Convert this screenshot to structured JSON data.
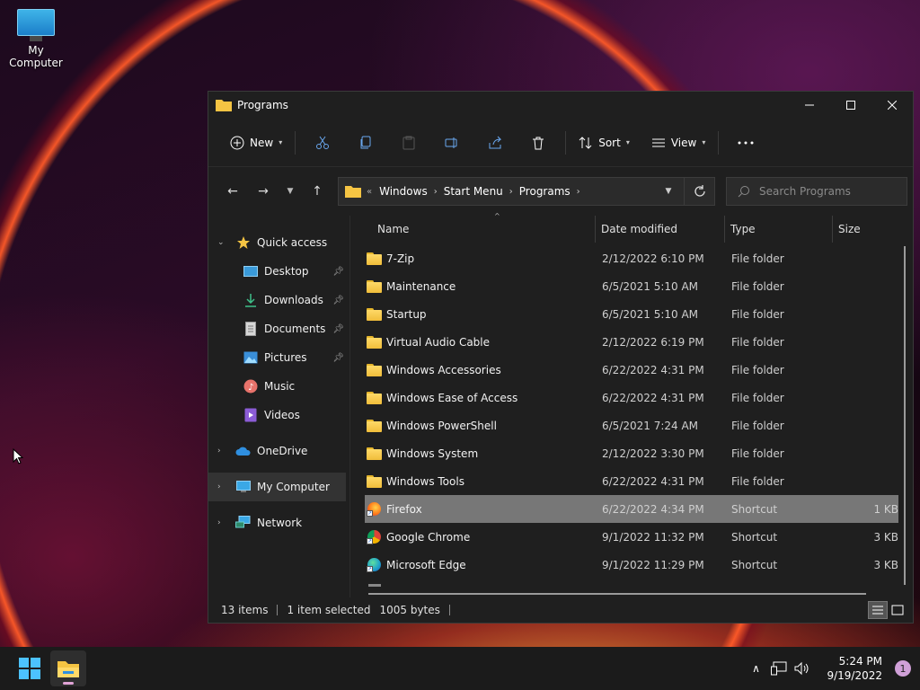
{
  "desktop": {
    "icon_label": "My Computer"
  },
  "window": {
    "title": "Programs",
    "toolbar": {
      "new_label": "New",
      "sort_label": "Sort",
      "view_label": "View"
    },
    "address": {
      "crumbs": [
        "Windows",
        "Start Menu",
        "Programs"
      ]
    },
    "search": {
      "placeholder": "Search Programs"
    },
    "sidebar": {
      "quick_access": "Quick access",
      "items": [
        {
          "label": "Desktop",
          "pinned": true
        },
        {
          "label": "Downloads",
          "pinned": true
        },
        {
          "label": "Documents",
          "pinned": true
        },
        {
          "label": "Pictures",
          "pinned": true
        },
        {
          "label": "Music",
          "pinned": false
        },
        {
          "label": "Videos",
          "pinned": false
        }
      ],
      "onedrive": "OneDrive",
      "mycomputer": "My Computer",
      "network": "Network"
    },
    "columns": {
      "name": "Name",
      "date": "Date modified",
      "type": "Type",
      "size": "Size"
    },
    "files": [
      {
        "name": "7-Zip",
        "date": "2/12/2022 6:10 PM",
        "type": "File folder",
        "size": ""
      },
      {
        "name": "Maintenance",
        "date": "6/5/2021 5:10 AM",
        "type": "File folder",
        "size": ""
      },
      {
        "name": "Startup",
        "date": "6/5/2021 5:10 AM",
        "type": "File folder",
        "size": ""
      },
      {
        "name": "Virtual Audio Cable",
        "date": "2/12/2022 6:19 PM",
        "type": "File folder",
        "size": ""
      },
      {
        "name": "Windows Accessories",
        "date": "6/22/2022 4:31 PM",
        "type": "File folder",
        "size": ""
      },
      {
        "name": "Windows Ease of Access",
        "date": "6/22/2022 4:31 PM",
        "type": "File folder",
        "size": ""
      },
      {
        "name": "Windows PowerShell",
        "date": "6/5/2021 7:24 AM",
        "type": "File folder",
        "size": ""
      },
      {
        "name": "Windows System",
        "date": "2/12/2022 3:30 PM",
        "type": "File folder",
        "size": ""
      },
      {
        "name": "Windows Tools",
        "date": "6/22/2022 4:31 PM",
        "type": "File folder",
        "size": ""
      },
      {
        "name": "Firefox",
        "date": "6/22/2022 4:34 PM",
        "type": "Shortcut",
        "size": "1 KB"
      },
      {
        "name": "Google Chrome",
        "date": "9/1/2022 11:32 PM",
        "type": "Shortcut",
        "size": "3 KB"
      },
      {
        "name": "Microsoft Edge",
        "date": "9/1/2022 11:29 PM",
        "type": "Shortcut",
        "size": "3 KB"
      }
    ],
    "status": {
      "count": "13 items",
      "selected": "1 item selected",
      "bytes": "1005 bytes"
    }
  },
  "taskbar": {
    "time": "5:24 PM",
    "date": "9/19/2022",
    "notifications": "1"
  }
}
